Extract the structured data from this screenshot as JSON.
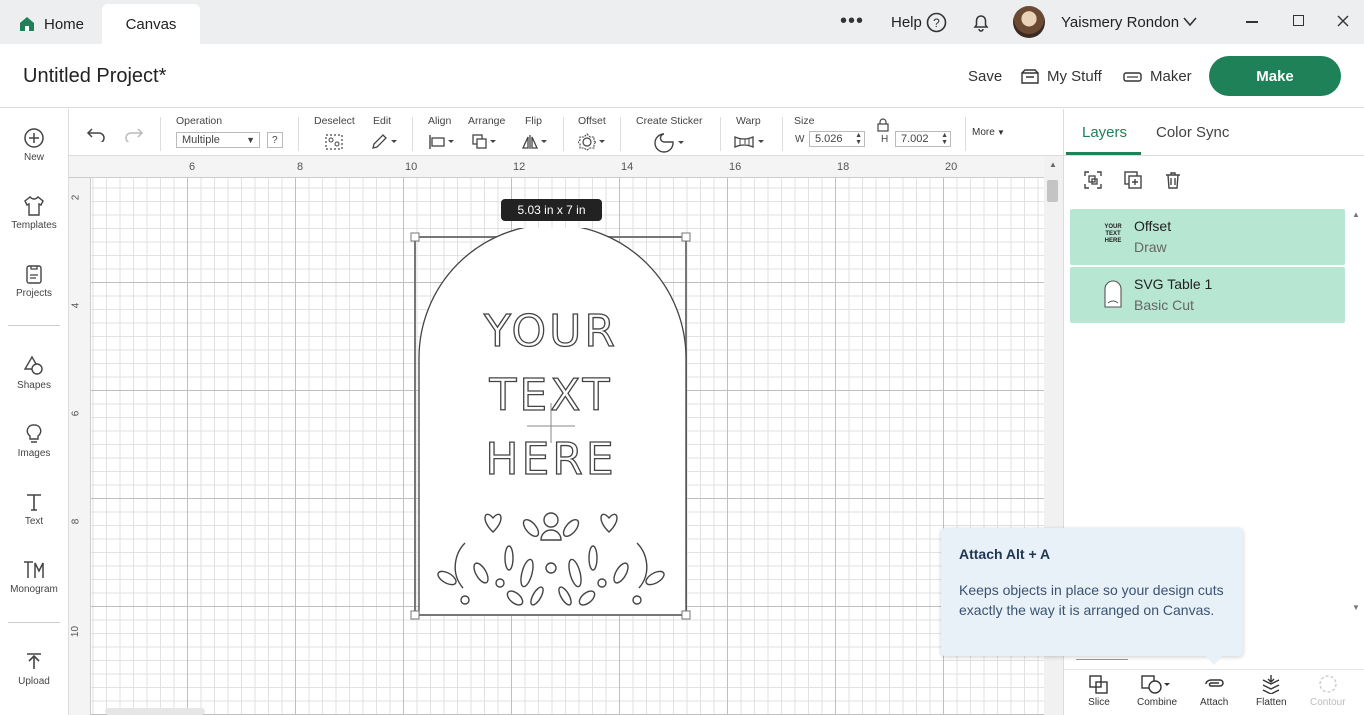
{
  "titlebar": {
    "home_tab": "Home",
    "canvas_tab": "Canvas",
    "help": "Help",
    "user_name": "Yaismery Rondon"
  },
  "project": {
    "title": "Untitled Project*",
    "save": "Save",
    "my_stuff": "My Stuff",
    "maker": "Maker",
    "make": "Make"
  },
  "sidebar": {
    "items": [
      {
        "label": "New",
        "icon": "plus-circle-icon"
      },
      {
        "label": "Templates",
        "icon": "tshirt-icon"
      },
      {
        "label": "Projects",
        "icon": "projects-icon"
      },
      {
        "label": "Shapes",
        "icon": "shapes-icon"
      },
      {
        "label": "Images",
        "icon": "lightbulb-icon"
      },
      {
        "label": "Text",
        "icon": "text-icon"
      },
      {
        "label": "Monogram",
        "icon": "monogram-icon"
      },
      {
        "label": "Upload",
        "icon": "upload-icon"
      }
    ]
  },
  "toolbar": {
    "operation_label": "Operation",
    "operation_value": "Multiple",
    "help_q": "?",
    "deselect": "Deselect",
    "edit": "Edit",
    "align": "Align",
    "arrange": "Arrange",
    "flip": "Flip",
    "offset": "Offset",
    "create_sticker": "Create Sticker",
    "warp": "Warp",
    "size": "Size",
    "w_label": "W",
    "w_value": "5.026",
    "h_label": "H",
    "h_value": "7.002",
    "more": "More"
  },
  "ruler": {
    "top": [
      "6",
      "8",
      "10",
      "12",
      "14",
      "16",
      "18",
      "20"
    ],
    "left": [
      "2",
      "4",
      "6",
      "8",
      "10"
    ]
  },
  "canvas": {
    "size_tooltip": "5.03  in x 7  in",
    "design_lines": [
      "YOUR",
      "TEXT",
      "HERE"
    ]
  },
  "layers_panel": {
    "tabs": [
      "Layers",
      "Color Sync"
    ],
    "layers": [
      {
        "name": "Offset",
        "type": "Draw",
        "thumb_text": "YOUR TEXT HERE"
      },
      {
        "name": "SVG Table 1",
        "type": "Basic Cut"
      }
    ]
  },
  "bottom_tools": [
    "Slice",
    "Combine",
    "Attach",
    "Flatten",
    "Contour"
  ],
  "tooltip": {
    "title": "Attach Alt + A",
    "body": "Keeps objects in place so your design cuts exactly the way it is arranged on Canvas."
  },
  "colors": {
    "accent": "#1e8158",
    "layer_highlight": "#b7e6d3",
    "tooltip_bg": "#e8f0f8"
  }
}
